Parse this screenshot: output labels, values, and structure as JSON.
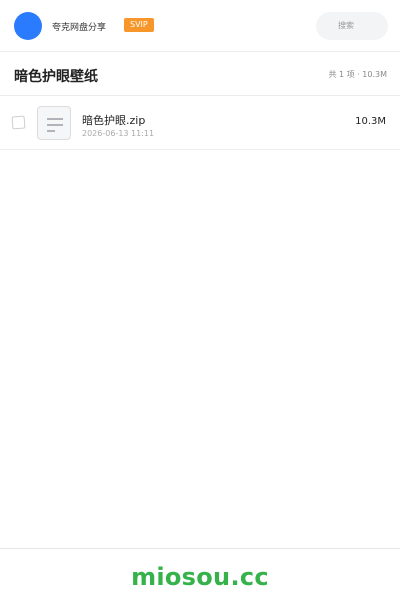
{
  "header": {
    "user_name": "夸克网盘分享",
    "vip_label": "SVIP",
    "search_placeholder": "搜索",
    "avatar_color": "#2b7bff"
  },
  "share": {
    "title": "暗色护眼壁纸",
    "summary": "共 1 项 · 10.3M"
  },
  "files": [
    {
      "name": "暗色护眼.zip",
      "date": "2026-06-13 11:11",
      "size": "10.3M",
      "icon": "archive-file-icon"
    }
  ],
  "footer": {
    "brand": "miosou.cc",
    "brand_color": "#35b24a"
  }
}
